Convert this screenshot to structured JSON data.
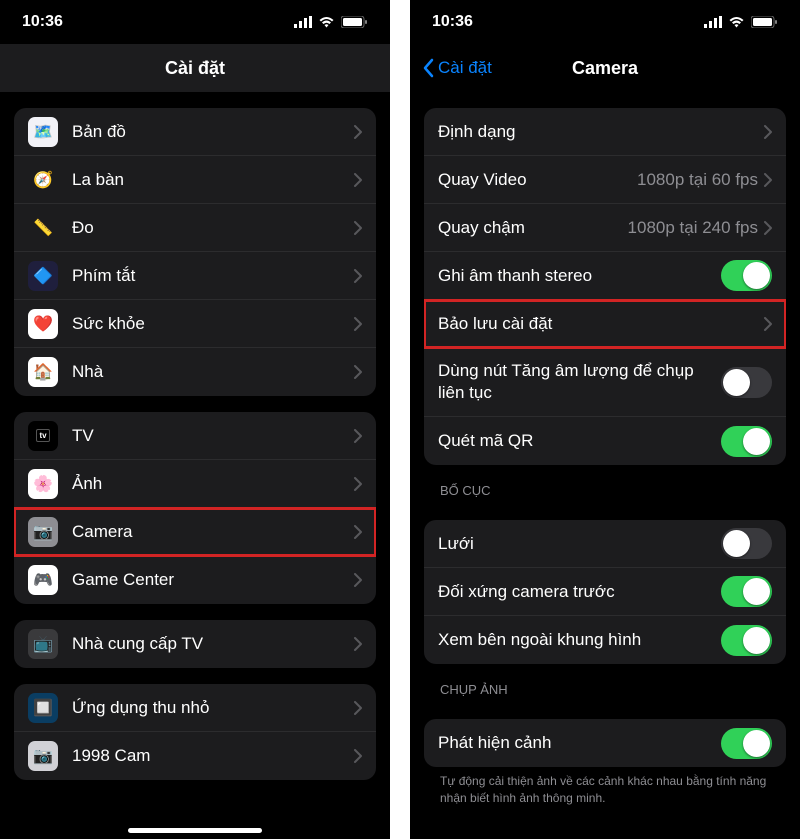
{
  "left": {
    "time": "10:36",
    "title": "Cài đặt",
    "groups": [
      {
        "items": [
          {
            "icon": "maps",
            "bg": "#f2f2f7",
            "glyph": "🗺️",
            "label": "Bản đồ"
          },
          {
            "icon": "compass",
            "bg": "#1c1c1e",
            "glyph": "🧭",
            "label": "La bàn"
          },
          {
            "icon": "measure",
            "bg": "#1c1c1e",
            "glyph": "📏",
            "label": "Đo"
          },
          {
            "icon": "shortcuts",
            "bg": "#1f1f3d",
            "glyph": "🔷",
            "label": "Phím tắt"
          },
          {
            "icon": "health",
            "bg": "#ffffff",
            "glyph": "❤️",
            "label": "Sức khỏe"
          },
          {
            "icon": "home",
            "bg": "#ffffff",
            "glyph": "🏠",
            "label": "Nhà"
          }
        ]
      },
      {
        "items": [
          {
            "icon": "tv",
            "bg": "#000000",
            "glyph": "tv",
            "label": "TV",
            "tv": true
          },
          {
            "icon": "photos",
            "bg": "#ffffff",
            "glyph": "🌸",
            "label": "Ảnh"
          },
          {
            "icon": "camera",
            "bg": "#8e8e93",
            "glyph": "📷",
            "label": "Camera",
            "highlight": true
          },
          {
            "icon": "gamecenter",
            "bg": "#ffffff",
            "glyph": "🎮",
            "label": "Game Center"
          }
        ]
      },
      {
        "items": [
          {
            "icon": "tvprovider",
            "bg": "#3a3a3c",
            "glyph": "📺",
            "label": "Nhà cung cấp TV"
          }
        ]
      },
      {
        "items": [
          {
            "icon": "miniapp",
            "bg": "#0a3d62",
            "glyph": "🔲",
            "label": "Ứng dụng thu nhỏ"
          },
          {
            "icon": "1998cam",
            "bg": "#d1d1d6",
            "glyph": "📷",
            "label": "1998 Cam"
          }
        ]
      }
    ]
  },
  "right": {
    "time": "10:36",
    "back": "Cài đặt",
    "title": "Camera",
    "group1": [
      {
        "type": "nav",
        "label": "Định dạng"
      },
      {
        "type": "nav",
        "label": "Quay Video",
        "value": "1080p tại 60 fps"
      },
      {
        "type": "nav",
        "label": "Quay chậm",
        "value": "1080p tại 240 fps"
      },
      {
        "type": "toggle",
        "label": "Ghi âm thanh stereo",
        "on": true
      },
      {
        "type": "nav",
        "label": "Bảo lưu cài đặt",
        "highlight": true
      },
      {
        "type": "toggle",
        "label": "Dùng nút Tăng âm lượng để chụp liên tục",
        "on": false,
        "multi": true
      },
      {
        "type": "toggle",
        "label": "Quét mã QR",
        "on": true
      }
    ],
    "section2_header": "BỐ CỤC",
    "group2": [
      {
        "type": "toggle",
        "label": "Lưới",
        "on": false
      },
      {
        "type": "toggle",
        "label": "Đối xứng camera trước",
        "on": true
      },
      {
        "type": "toggle",
        "label": "Xem bên ngoài khung hình",
        "on": true
      }
    ],
    "section3_header": "CHỤP ẢNH",
    "group3": [
      {
        "type": "toggle",
        "label": "Phát hiện cảnh",
        "on": true
      }
    ],
    "footer": "Tự động cải thiện ảnh về các cảnh khác nhau bằng tính năng nhận biết hình ảnh thông minh."
  }
}
